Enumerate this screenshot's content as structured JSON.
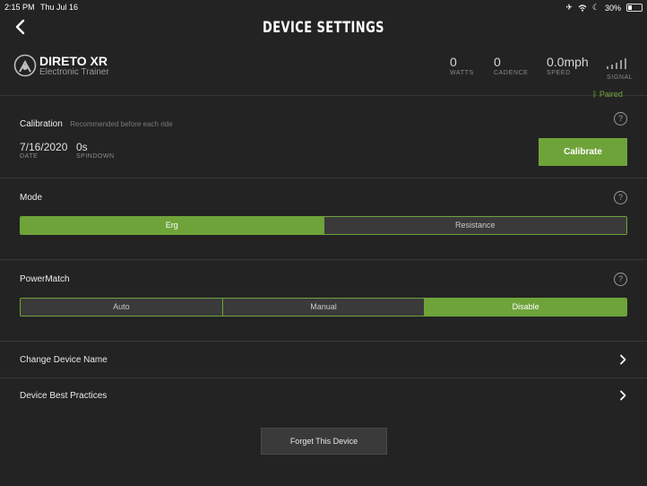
{
  "status_bar": {
    "time": "2:15 PM",
    "date": "Thu Jul 16",
    "battery": "30%"
  },
  "header": {
    "title": "DEVICE SETTINGS"
  },
  "device": {
    "name": "DIRETO XR",
    "type": "Electronic Trainer",
    "stats": [
      {
        "value": "0",
        "label": "WATTS"
      },
      {
        "value": "0",
        "label": "CADENCE"
      },
      {
        "value": "0.0mph",
        "label": "SPEED"
      }
    ],
    "signal_label": "SIGNAL",
    "connection": "Paired"
  },
  "calibration": {
    "title": "Calibration",
    "hint": "Recommended before each ride",
    "date_value": "7/16/2020",
    "date_label": "DATE",
    "spindown_value": "0s",
    "spindown_label": "SPINDOWN",
    "button": "Calibrate"
  },
  "mode": {
    "title": "Mode",
    "options": [
      "Erg",
      "Resistance"
    ],
    "selected": "Erg"
  },
  "powermatch": {
    "title": "PowerMatch",
    "options": [
      "Auto",
      "Manual",
      "Disable"
    ],
    "selected": "Disable"
  },
  "links": {
    "change_name": "Change Device Name",
    "best_practices": "Device Best Practices"
  },
  "forget_button": "Forget This Device",
  "colors": {
    "background": "#232323",
    "accent_green": "#6ea33a",
    "divider": "#383838"
  }
}
